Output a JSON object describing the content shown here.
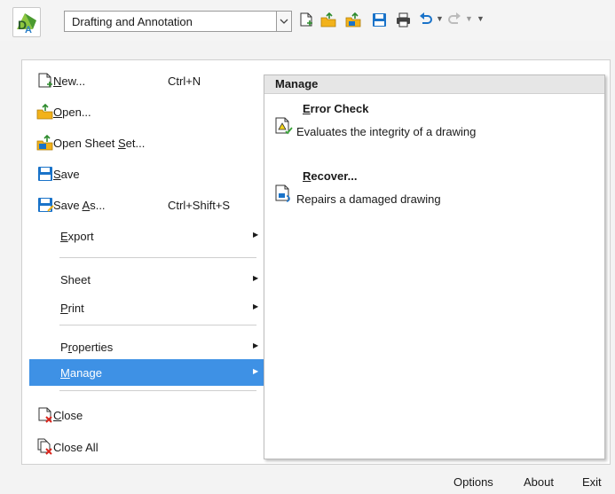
{
  "toolbar": {
    "workspace_value": "Drafting and Annotation",
    "icons": [
      "app-logo-icon",
      "new-file-icon",
      "open-folder-icon",
      "open-sheet-set-icon",
      "save-icon",
      "print-icon",
      "undo-icon",
      "redo-icon",
      "customize-icon"
    ]
  },
  "menu": {
    "items": [
      {
        "id": "new",
        "pre": "",
        "acc": "N",
        "post": "ew...",
        "shortcut": "Ctrl+N",
        "icon": "new-file-icon"
      },
      {
        "id": "open",
        "pre": "",
        "acc": "O",
        "post": "pen...",
        "shortcut": "",
        "icon": "open-folder-icon"
      },
      {
        "id": "open-sheet-set",
        "pre": "Open Sheet ",
        "acc": "S",
        "post": "et...",
        "shortcut": "",
        "icon": "open-sheet-set-icon"
      },
      {
        "id": "save",
        "pre": "",
        "acc": "S",
        "post": "ave",
        "shortcut": "",
        "icon": "save-icon"
      },
      {
        "id": "save-as",
        "pre": "Save ",
        "acc": "A",
        "post": "s...",
        "shortcut": "Ctrl+Shift+S",
        "icon": "save-as-icon"
      },
      {
        "id": "export",
        "pre": "",
        "acc": "E",
        "post": "xport",
        "shortcut": "",
        "icon": ""
      },
      {
        "id": "sheet",
        "pre": "Sheet",
        "acc": "",
        "post": "",
        "shortcut": "",
        "icon": ""
      },
      {
        "id": "print",
        "pre": "",
        "acc": "P",
        "post": "rint",
        "shortcut": "",
        "icon": ""
      },
      {
        "id": "properties",
        "pre": "P",
        "acc": "r",
        "post": "operties",
        "shortcut": "",
        "icon": ""
      },
      {
        "id": "manage",
        "pre": "",
        "acc": "M",
        "post": "anage",
        "shortcut": "",
        "icon": ""
      },
      {
        "id": "close",
        "pre": "",
        "acc": "C",
        "post": "lose",
        "shortcut": "",
        "icon": "close-icon"
      },
      {
        "id": "close-all",
        "pre": "Close All",
        "acc": "",
        "post": "",
        "shortcut": "",
        "icon": "close-all-icon"
      }
    ],
    "active_item": "manage"
  },
  "flyout": {
    "header": "Manage",
    "items": [
      {
        "title": "Error Check",
        "accel": "E",
        "rest": "rror Check",
        "description": "Evaluates the integrity of a drawing",
        "icon": "error-check-icon"
      },
      {
        "title": "Recover...",
        "accel": "R",
        "rest": "ecover...",
        "description": "Repairs a damaged drawing",
        "icon": "recover-icon"
      }
    ]
  },
  "footer": {
    "options_label": "Options",
    "about_label": "About",
    "exit_label": "Exit"
  },
  "colors": {
    "accent": "#3e91e5",
    "icon_yellow": "#f2b21b",
    "icon_blue": "#1a73c9",
    "icon_green": "#3aa33a",
    "icon_red": "#d9241c"
  }
}
